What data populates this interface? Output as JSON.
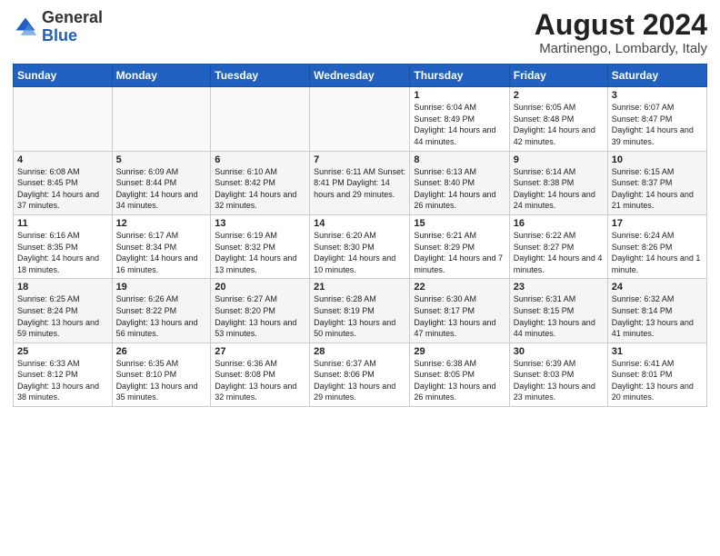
{
  "logo": {
    "general": "General",
    "blue": "Blue"
  },
  "header": {
    "month_year": "August 2024",
    "location": "Martinengo, Lombardy, Italy"
  },
  "days_of_week": [
    "Sunday",
    "Monday",
    "Tuesday",
    "Wednesday",
    "Thursday",
    "Friday",
    "Saturday"
  ],
  "weeks": [
    [
      {
        "day": "",
        "info": ""
      },
      {
        "day": "",
        "info": ""
      },
      {
        "day": "",
        "info": ""
      },
      {
        "day": "",
        "info": ""
      },
      {
        "day": "1",
        "info": "Sunrise: 6:04 AM\nSunset: 8:49 PM\nDaylight: 14 hours\nand 44 minutes."
      },
      {
        "day": "2",
        "info": "Sunrise: 6:05 AM\nSunset: 8:48 PM\nDaylight: 14 hours\nand 42 minutes."
      },
      {
        "day": "3",
        "info": "Sunrise: 6:07 AM\nSunset: 8:47 PM\nDaylight: 14 hours\nand 39 minutes."
      }
    ],
    [
      {
        "day": "4",
        "info": "Sunrise: 6:08 AM\nSunset: 8:45 PM\nDaylight: 14 hours\nand 37 minutes."
      },
      {
        "day": "5",
        "info": "Sunrise: 6:09 AM\nSunset: 8:44 PM\nDaylight: 14 hours\nand 34 minutes."
      },
      {
        "day": "6",
        "info": "Sunrise: 6:10 AM\nSunset: 8:42 PM\nDaylight: 14 hours\nand 32 minutes."
      },
      {
        "day": "7",
        "info": "Sunrise: 6:11 AM\nSunset: 8:41 PM\nDaylight: 14 hours\nand 29 minutes."
      },
      {
        "day": "8",
        "info": "Sunrise: 6:13 AM\nSunset: 8:40 PM\nDaylight: 14 hours\nand 26 minutes."
      },
      {
        "day": "9",
        "info": "Sunrise: 6:14 AM\nSunset: 8:38 PM\nDaylight: 14 hours\nand 24 minutes."
      },
      {
        "day": "10",
        "info": "Sunrise: 6:15 AM\nSunset: 8:37 PM\nDaylight: 14 hours\nand 21 minutes."
      }
    ],
    [
      {
        "day": "11",
        "info": "Sunrise: 6:16 AM\nSunset: 8:35 PM\nDaylight: 14 hours\nand 18 minutes."
      },
      {
        "day": "12",
        "info": "Sunrise: 6:17 AM\nSunset: 8:34 PM\nDaylight: 14 hours\nand 16 minutes."
      },
      {
        "day": "13",
        "info": "Sunrise: 6:19 AM\nSunset: 8:32 PM\nDaylight: 14 hours\nand 13 minutes."
      },
      {
        "day": "14",
        "info": "Sunrise: 6:20 AM\nSunset: 8:30 PM\nDaylight: 14 hours\nand 10 minutes."
      },
      {
        "day": "15",
        "info": "Sunrise: 6:21 AM\nSunset: 8:29 PM\nDaylight: 14 hours\nand 7 minutes."
      },
      {
        "day": "16",
        "info": "Sunrise: 6:22 AM\nSunset: 8:27 PM\nDaylight: 14 hours\nand 4 minutes."
      },
      {
        "day": "17",
        "info": "Sunrise: 6:24 AM\nSunset: 8:26 PM\nDaylight: 14 hours\nand 1 minute."
      }
    ],
    [
      {
        "day": "18",
        "info": "Sunrise: 6:25 AM\nSunset: 8:24 PM\nDaylight: 13 hours\nand 59 minutes."
      },
      {
        "day": "19",
        "info": "Sunrise: 6:26 AM\nSunset: 8:22 PM\nDaylight: 13 hours\nand 56 minutes."
      },
      {
        "day": "20",
        "info": "Sunrise: 6:27 AM\nSunset: 8:20 PM\nDaylight: 13 hours\nand 53 minutes."
      },
      {
        "day": "21",
        "info": "Sunrise: 6:28 AM\nSunset: 8:19 PM\nDaylight: 13 hours\nand 50 minutes."
      },
      {
        "day": "22",
        "info": "Sunrise: 6:30 AM\nSunset: 8:17 PM\nDaylight: 13 hours\nand 47 minutes."
      },
      {
        "day": "23",
        "info": "Sunrise: 6:31 AM\nSunset: 8:15 PM\nDaylight: 13 hours\nand 44 minutes."
      },
      {
        "day": "24",
        "info": "Sunrise: 6:32 AM\nSunset: 8:14 PM\nDaylight: 13 hours\nand 41 minutes."
      }
    ],
    [
      {
        "day": "25",
        "info": "Sunrise: 6:33 AM\nSunset: 8:12 PM\nDaylight: 13 hours\nand 38 minutes."
      },
      {
        "day": "26",
        "info": "Sunrise: 6:35 AM\nSunset: 8:10 PM\nDaylight: 13 hours\nand 35 minutes."
      },
      {
        "day": "27",
        "info": "Sunrise: 6:36 AM\nSunset: 8:08 PM\nDaylight: 13 hours\nand 32 minutes."
      },
      {
        "day": "28",
        "info": "Sunrise: 6:37 AM\nSunset: 8:06 PM\nDaylight: 13 hours\nand 29 minutes."
      },
      {
        "day": "29",
        "info": "Sunrise: 6:38 AM\nSunset: 8:05 PM\nDaylight: 13 hours\nand 26 minutes."
      },
      {
        "day": "30",
        "info": "Sunrise: 6:39 AM\nSunset: 8:03 PM\nDaylight: 13 hours\nand 23 minutes."
      },
      {
        "day": "31",
        "info": "Sunrise: 6:41 AM\nSunset: 8:01 PM\nDaylight: 13 hours\nand 20 minutes."
      }
    ]
  ]
}
